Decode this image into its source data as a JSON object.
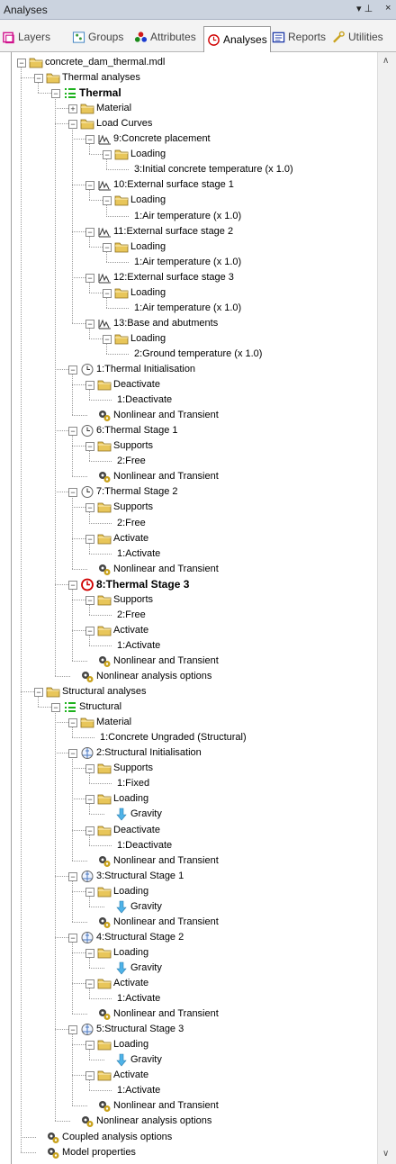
{
  "panel": {
    "title": "Analyses",
    "pin": "▾  ⊥",
    "close": "×"
  },
  "tabs": [
    {
      "label": "Layers",
      "icon": "layers-icon",
      "active": false
    },
    {
      "label": "Groups",
      "icon": "groups-icon",
      "active": false
    },
    {
      "label": "Attributes",
      "icon": "attributes-icon",
      "active": false
    },
    {
      "label": "Analyses",
      "icon": "analyses-icon",
      "active": true
    },
    {
      "label": "Reports",
      "icon": "reports-icon",
      "active": false
    },
    {
      "label": "Utilities",
      "icon": "utilities-icon",
      "active": false
    }
  ],
  "tree": [
    {
      "label": "concrete_dam_thermal.mdl",
      "icon": "folder",
      "depth": 0,
      "expanded": true
    },
    {
      "label": "Thermal analyses",
      "icon": "folder",
      "depth": 1,
      "expanded": true
    },
    {
      "label": "Thermal",
      "icon": "analysis",
      "depth": 2,
      "expanded": true,
      "bold": true
    },
    {
      "label": "Material",
      "icon": "folder",
      "depth": 3,
      "expanded": false
    },
    {
      "label": "Load Curves",
      "icon": "folder",
      "depth": 3,
      "expanded": true
    },
    {
      "label": "9:Concrete placement",
      "icon": "curve",
      "depth": 4,
      "expanded": true
    },
    {
      "label": "Loading",
      "icon": "folder",
      "depth": 5,
      "expanded": true
    },
    {
      "label": "3:Initial concrete temperature (x 1.0)",
      "icon": "none",
      "depth": 6
    },
    {
      "label": "10:External surface stage 1",
      "icon": "curve",
      "depth": 4,
      "expanded": true
    },
    {
      "label": "Loading",
      "icon": "folder",
      "depth": 5,
      "expanded": true
    },
    {
      "label": "1:Air temperature (x 1.0)",
      "icon": "none",
      "depth": 6
    },
    {
      "label": "11:External surface stage 2",
      "icon": "curve",
      "depth": 4,
      "expanded": true
    },
    {
      "label": "Loading",
      "icon": "folder",
      "depth": 5,
      "expanded": true
    },
    {
      "label": "1:Air temperature (x 1.0)",
      "icon": "none",
      "depth": 6
    },
    {
      "label": "12:External surface stage 3",
      "icon": "curve",
      "depth": 4,
      "expanded": true
    },
    {
      "label": "Loading",
      "icon": "folder",
      "depth": 5,
      "expanded": true
    },
    {
      "label": "1:Air temperature (x 1.0)",
      "icon": "none",
      "depth": 6
    },
    {
      "label": "13:Base and abutments",
      "icon": "curve",
      "depth": 4,
      "expanded": true
    },
    {
      "label": "Loading",
      "icon": "folder",
      "depth": 5,
      "expanded": true
    },
    {
      "label": "2:Ground temperature (x 1.0)",
      "icon": "none",
      "depth": 6
    },
    {
      "label": "1:Thermal Initialisation",
      "icon": "clock",
      "depth": 3,
      "expanded": true
    },
    {
      "label": "Deactivate",
      "icon": "folder",
      "depth": 4,
      "expanded": true
    },
    {
      "label": "1:Deactivate",
      "icon": "none",
      "depth": 5
    },
    {
      "label": "Nonlinear and Transient",
      "icon": "gears",
      "depth": 4
    },
    {
      "label": "6:Thermal Stage 1",
      "icon": "clock",
      "depth": 3,
      "expanded": true
    },
    {
      "label": "Supports",
      "icon": "folder",
      "depth": 4,
      "expanded": true
    },
    {
      "label": "2:Free",
      "icon": "none",
      "depth": 5
    },
    {
      "label": "Nonlinear and Transient",
      "icon": "gears",
      "depth": 4
    },
    {
      "label": "7:Thermal Stage 2",
      "icon": "clock",
      "depth": 3,
      "expanded": true
    },
    {
      "label": "Supports",
      "icon": "folder",
      "depth": 4,
      "expanded": true
    },
    {
      "label": "2:Free",
      "icon": "none",
      "depth": 5
    },
    {
      "label": "Activate",
      "icon": "folder",
      "depth": 4,
      "expanded": true
    },
    {
      "label": "1:Activate",
      "icon": "none",
      "depth": 5
    },
    {
      "label": "Nonlinear and Transient",
      "icon": "gears",
      "depth": 4
    },
    {
      "label": "8:Thermal Stage 3",
      "icon": "clock-active",
      "depth": 3,
      "expanded": true,
      "bold": true
    },
    {
      "label": "Supports",
      "icon": "folder",
      "depth": 4,
      "expanded": true
    },
    {
      "label": "2:Free",
      "icon": "none",
      "depth": 5
    },
    {
      "label": "Activate",
      "icon": "folder",
      "depth": 4,
      "expanded": true
    },
    {
      "label": "1:Activate",
      "icon": "none",
      "depth": 5
    },
    {
      "label": "Nonlinear and Transient",
      "icon": "gears",
      "depth": 4
    },
    {
      "label": "Nonlinear analysis options",
      "icon": "gears",
      "depth": 3
    },
    {
      "label": "Structural analyses",
      "icon": "folder",
      "depth": 1,
      "expanded": true
    },
    {
      "label": "Structural",
      "icon": "analysis",
      "depth": 2,
      "expanded": true
    },
    {
      "label": "Material",
      "icon": "folder",
      "depth": 3,
      "expanded": true
    },
    {
      "label": "1:Concrete Ungraded (Structural)",
      "icon": "none",
      "depth": 4
    },
    {
      "label": "2:Structural Initialisation",
      "icon": "struct",
      "depth": 3,
      "expanded": true
    },
    {
      "label": "Supports",
      "icon": "folder",
      "depth": 4,
      "expanded": true
    },
    {
      "label": "1:Fixed",
      "icon": "none",
      "depth": 5
    },
    {
      "label": "Loading",
      "icon": "folder",
      "depth": 4,
      "expanded": true
    },
    {
      "label": "Gravity",
      "icon": "arrow",
      "depth": 5
    },
    {
      "label": "Deactivate",
      "icon": "folder",
      "depth": 4,
      "expanded": true
    },
    {
      "label": "1:Deactivate",
      "icon": "none",
      "depth": 5
    },
    {
      "label": "Nonlinear and Transient",
      "icon": "gears",
      "depth": 4
    },
    {
      "label": "3:Structural Stage 1",
      "icon": "struct",
      "depth": 3,
      "expanded": true
    },
    {
      "label": "Loading",
      "icon": "folder",
      "depth": 4,
      "expanded": true
    },
    {
      "label": "Gravity",
      "icon": "arrow",
      "depth": 5
    },
    {
      "label": "Nonlinear and Transient",
      "icon": "gears",
      "depth": 4
    },
    {
      "label": "4:Structural Stage 2",
      "icon": "struct",
      "depth": 3,
      "expanded": true
    },
    {
      "label": "Loading",
      "icon": "folder",
      "depth": 4,
      "expanded": true
    },
    {
      "label": "Gravity",
      "icon": "arrow",
      "depth": 5
    },
    {
      "label": "Activate",
      "icon": "folder",
      "depth": 4,
      "expanded": true
    },
    {
      "label": "1:Activate",
      "icon": "none",
      "depth": 5
    },
    {
      "label": "Nonlinear and Transient",
      "icon": "gears",
      "depth": 4
    },
    {
      "label": "5:Structural Stage 3",
      "icon": "struct",
      "depth": 3,
      "expanded": true
    },
    {
      "label": "Loading",
      "icon": "folder",
      "depth": 4,
      "expanded": true
    },
    {
      "label": "Gravity",
      "icon": "arrow",
      "depth": 5
    },
    {
      "label": "Activate",
      "icon": "folder",
      "depth": 4,
      "expanded": true
    },
    {
      "label": "1:Activate",
      "icon": "none",
      "depth": 5
    },
    {
      "label": "Nonlinear and Transient",
      "icon": "gears",
      "depth": 4
    },
    {
      "label": "Nonlinear analysis options",
      "icon": "gears",
      "depth": 3
    },
    {
      "label": "Coupled analysis options",
      "icon": "gears",
      "depth": 1
    },
    {
      "label": "Model properties",
      "icon": "gears",
      "depth": 1
    }
  ],
  "colors": {
    "folder": "#e8c65a",
    "analysis": "#1db21d",
    "clock_active": "#d00000",
    "arrow": "#4fb3e8"
  }
}
